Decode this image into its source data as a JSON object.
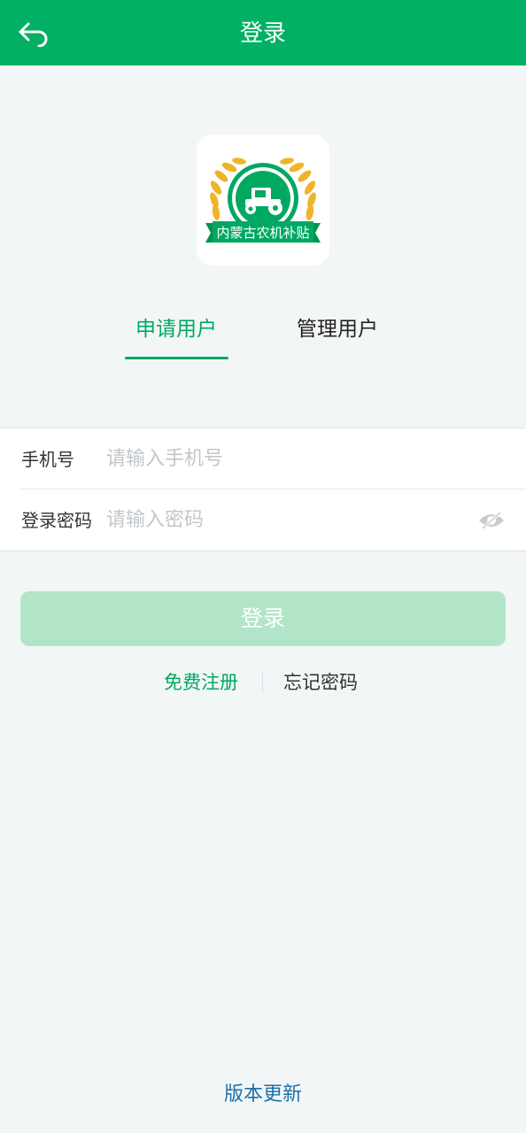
{
  "header": {
    "title": "登录"
  },
  "logo": {
    "text": "内蒙古农机补贴"
  },
  "tabs": [
    {
      "label": "申请用户",
      "active": true
    },
    {
      "label": "管理用户",
      "active": false
    }
  ],
  "form": {
    "phone": {
      "label": "手机号",
      "placeholder": "请输入手机号",
      "value": ""
    },
    "password": {
      "label": "登录密码",
      "placeholder": "请输入密码",
      "value": ""
    }
  },
  "login_button": {
    "label": "登录"
  },
  "links": {
    "register": "免费注册",
    "forgot": "忘记密码"
  },
  "footer": {
    "version_update": "版本更新"
  },
  "colors": {
    "brand_green": "#01b064",
    "tab_active": "#01a862",
    "button_disabled": "#b2e5c8",
    "link_blue": "#1d6fa9",
    "background": "#f3f6f7"
  }
}
